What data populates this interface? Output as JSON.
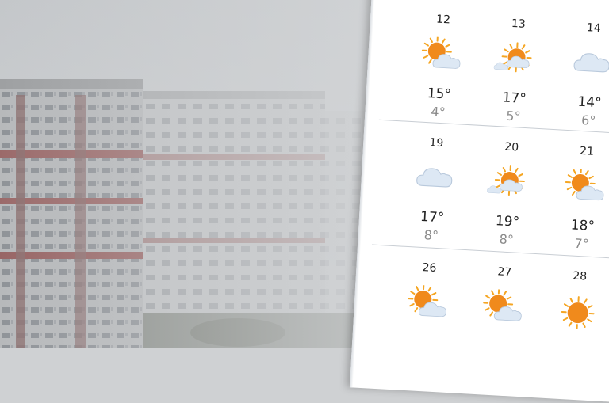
{
  "forecast": {
    "rows": [
      [
        {
          "date": "12",
          "icon": "partly-sunny-icon",
          "high": "15°",
          "low": "4°"
        },
        {
          "date": "13",
          "icon": "sun-behind-cloud-icon",
          "high": "17°",
          "low": "5°"
        },
        {
          "date": "14",
          "icon": "cloud-icon",
          "high": "14°",
          "low": "6°"
        }
      ],
      [
        {
          "date": "19",
          "icon": "cloud-icon",
          "high": "17°",
          "low": "8°"
        },
        {
          "date": "20",
          "icon": "sun-behind-cloud-icon",
          "high": "19°",
          "low": "8°"
        },
        {
          "date": "21",
          "icon": "partly-sunny-icon",
          "high": "18°",
          "low": "7°"
        }
      ],
      [
        {
          "date": "26",
          "icon": "partly-sunny-icon"
        },
        {
          "date": "27",
          "icon": "partly-sunny-icon"
        },
        {
          "date": "28",
          "icon": "sunny-icon"
        }
      ]
    ]
  },
  "colors": {
    "sun": "#f5a623",
    "sun_core": "#f08a1c",
    "cloud": "#dde8f4",
    "cloud_edge": "#b9c9dc"
  }
}
